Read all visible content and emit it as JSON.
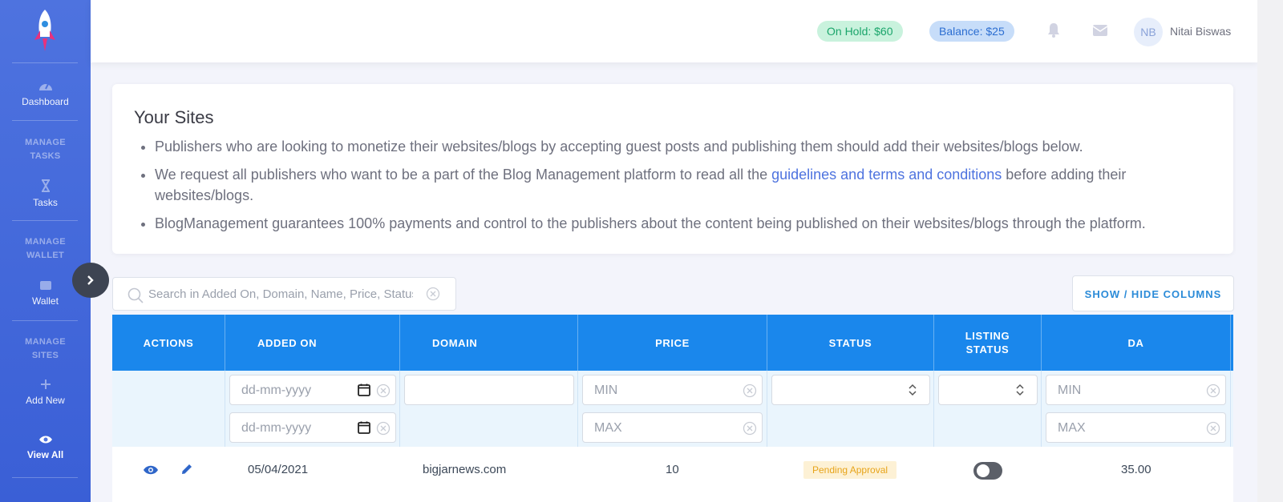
{
  "sidebar": {
    "dashboard": "Dashboard",
    "manage_tasks": "MANAGE\nTASKS",
    "tasks": "Tasks",
    "manage_wallet": "MANAGE\nWALLET",
    "wallet": "Wallet",
    "manage_sites": "MANAGE\nSITES",
    "add_new": "Add New",
    "view_all": "View All"
  },
  "topbar": {
    "on_hold": "On Hold: $60",
    "balance": "Balance: $25",
    "avatar_initials": "NB",
    "user_name": "Nitai Biswas"
  },
  "info": {
    "title": "Your Sites",
    "bullet1": "Publishers who are looking to monetize their websites/blogs by accepting guest posts and publishing them should add their websites/blogs below.",
    "bullet2_pre": "We request all publishers who want to be a part of the Blog Management platform to read all the ",
    "bullet2_link": "guidelines and terms and conditions",
    "bullet2_post": " before adding their websites/blogs.",
    "bullet3": "BlogManagement guarantees 100% payments and control to the publishers about the content being published on their websites/blogs through the platform."
  },
  "search": {
    "placeholder": "Search in Added On, Domain, Name, Price, Status"
  },
  "show_hide_label": "SHOW / HIDE COLUMNS",
  "table": {
    "headers": {
      "actions": "ACTIONS",
      "added_on": "ADDED ON",
      "domain": "DOMAIN",
      "price": "PRICE",
      "status": "STATUS",
      "listing_status": "LISTING STATUS",
      "da": "DA"
    },
    "filters": {
      "date_placeholder": "dd-mm-yyyy",
      "min": "MIN",
      "max": "MAX"
    },
    "rows": [
      {
        "added_on": "05/04/2021",
        "domain": "bigjarnews.com",
        "price": "10",
        "status": "Pending Approval",
        "listing_on": false,
        "da": "35.00"
      }
    ]
  },
  "colors": {
    "sidebar": "#4e73df",
    "table_header": "#1a87ec",
    "hold_pill": "#c9f2dd",
    "balance_pill": "#c7ddf9"
  }
}
